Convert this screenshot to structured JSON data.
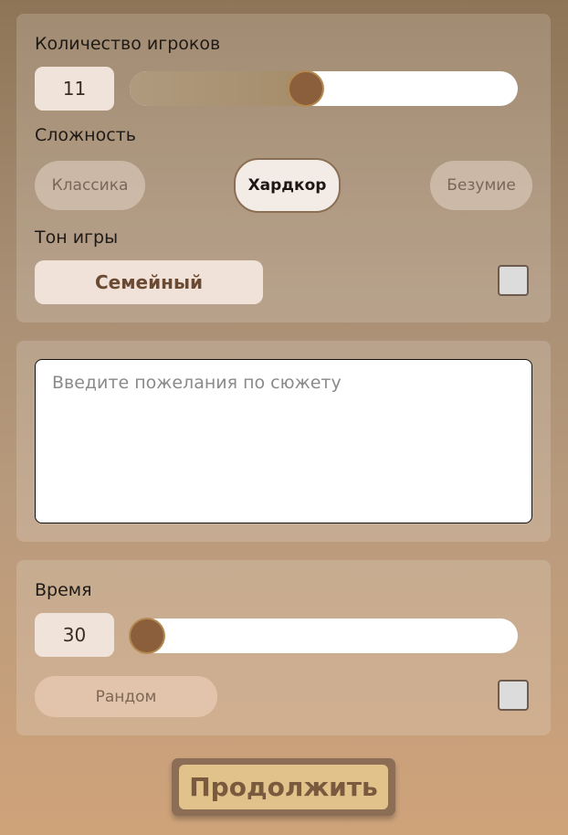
{
  "players": {
    "label": "Количество игроков",
    "value": "11",
    "slider_fraction": 0.46
  },
  "difficulty": {
    "label": "Сложность",
    "options": [
      "Классика",
      "Хардкор",
      "Безумие"
    ],
    "selected": "Хардкор"
  },
  "tone": {
    "label": "Тон игры",
    "value": "Семейный",
    "checkbox_checked": false
  },
  "plot": {
    "placeholder": "Введите пожелания по сюжету",
    "value": ""
  },
  "time": {
    "label": "Время",
    "value": "30",
    "slider_fraction": 0.0,
    "random_label": "Рандом",
    "checkbox_checked": false
  },
  "continue_label": "Продолжить",
  "colors": {
    "accent": "#8b5e3c",
    "button_fill": "#e1c28a",
    "chip_selected": "#f3ece6"
  }
}
